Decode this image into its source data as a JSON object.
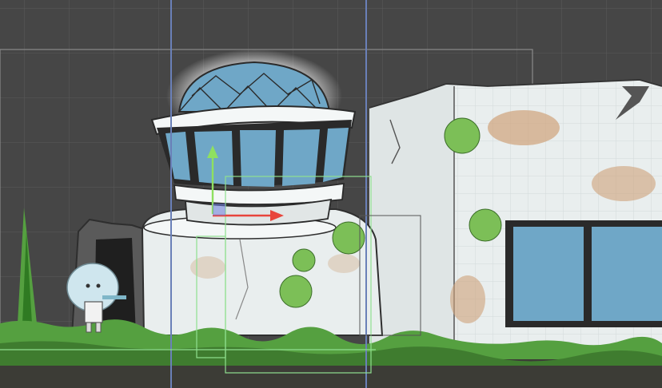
{
  "editor": {
    "background_color": "#464646",
    "grid_color": "#5a5a5a",
    "camera_bounds_color": "#8a8a8a",
    "guide_color": "#6a80b8",
    "collider_color": "#8fe08f",
    "gizmo_x_color": "#e8453c",
    "gizmo_y_color": "#8fe060",
    "gizmo_center_color": "#6f7fe0"
  },
  "scene": {
    "sky_color": "#464646",
    "glass_color": "#6fa7c7",
    "wall_color": "#e9eeee",
    "stain_color": "#cfa27a",
    "grass_color": "#55a040",
    "soil_color": "#3c3c36",
    "character": {
      "hair_color": "#cfe6ee",
      "outfit_color": "#f2f2f2"
    }
  },
  "objects": [
    {
      "id": "observatory-dome",
      "icon": "dome"
    },
    {
      "id": "tower-base",
      "icon": "rock"
    },
    {
      "id": "cave-entrance",
      "icon": "cave"
    },
    {
      "id": "ruined-building",
      "icon": "building"
    },
    {
      "id": "player-character",
      "icon": "character"
    },
    {
      "id": "ground-tilemap",
      "icon": "grass"
    }
  ]
}
